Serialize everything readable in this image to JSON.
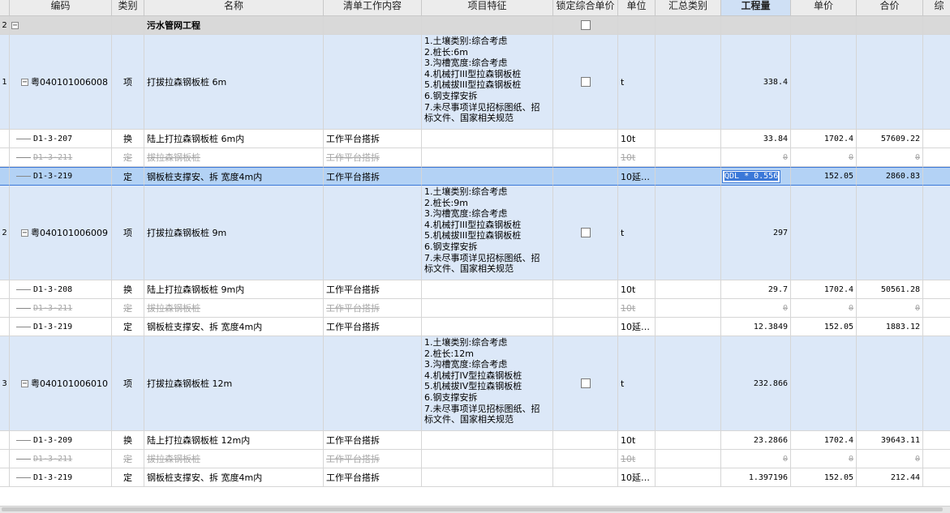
{
  "columns": [
    "编码",
    "类别",
    "名称",
    "清单工作内容",
    "项目特征",
    "锁定综合单价",
    "单位",
    "汇总类别",
    "工程量",
    "单价",
    "合价",
    "综"
  ],
  "rows": [
    {
      "type": "group",
      "idx": "2",
      "code": "",
      "cat": "",
      "name": "污水管网工程",
      "work": "",
      "unit": "",
      "qty": "",
      "price": "",
      "total": ""
    },
    {
      "type": "item",
      "idx": "1",
      "code": "粤040101006008",
      "cat": "项",
      "name": "打拔拉森钢板桩 6m",
      "work": "",
      "unit": "t",
      "qty": "338.4",
      "price": "",
      "total": "",
      "features": [
        "1.土壤类别:综合考虑",
        "2.桩长:6m",
        "3.沟槽宽度:综合考虑",
        "4.机械打III型拉森钢板桩",
        "5.机械拔III型拉森钢板桩",
        "6.钢支撑安拆",
        "7.未尽事项详见招标图纸、招",
        "标文件、国家相关规范"
      ]
    },
    {
      "type": "sub",
      "code": "D1-3-207",
      "cat": "换",
      "name": "陆上打拉森钢板桩 6m内",
      "work": "工作平台搭拆",
      "unit": "10t",
      "qty": "33.84",
      "price": "1702.4",
      "total": "57609.22"
    },
    {
      "type": "struck",
      "code": "D1-3-211",
      "cat": "定",
      "name": "拔拉森钢板桩",
      "work": "工作平台搭拆",
      "unit": "10t",
      "qty": "0",
      "price": "0",
      "total": "0"
    },
    {
      "type": "sel",
      "code": "D1-3-219",
      "cat": "定",
      "name": "钢板桩支撑安、拆 宽度4m内",
      "work": "工作平台搭拆",
      "unit": "10延…",
      "qty": "QDL * 0.556",
      "price": "152.05",
      "total": "2860.83"
    },
    {
      "type": "item",
      "idx": "2",
      "code": "粤040101006009",
      "cat": "项",
      "name": "打拔拉森钢板桩 9m",
      "work": "",
      "unit": "t",
      "qty": "297",
      "price": "",
      "total": "",
      "features": [
        "1.土壤类别:综合考虑",
        "2.桩长:9m",
        "3.沟槽宽度:综合考虑",
        "4.机械打III型拉森钢板桩",
        "5.机械拔III型拉森钢板桩",
        "6.钢支撑安拆",
        "7.未尽事项详见招标图纸、招",
        "标文件、国家相关规范"
      ]
    },
    {
      "type": "sub",
      "code": "D1-3-208",
      "cat": "换",
      "name": "陆上打拉森钢板桩 9m内",
      "work": "工作平台搭拆",
      "unit": "10t",
      "qty": "29.7",
      "price": "1702.4",
      "total": "50561.28"
    },
    {
      "type": "struck",
      "code": "D1-3-211",
      "cat": "定",
      "name": "拔拉森钢板桩",
      "work": "工作平台搭拆",
      "unit": "10t",
      "qty": "0",
      "price": "0",
      "total": "0"
    },
    {
      "type": "sub",
      "code": "D1-3-219",
      "cat": "定",
      "name": "钢板桩支撑安、拆 宽度4m内",
      "work": "工作平台搭拆",
      "unit": "10延…",
      "qty": "12.3849",
      "price": "152.05",
      "total": "1883.12"
    },
    {
      "type": "item",
      "idx": "3",
      "code": "粤040101006010",
      "cat": "项",
      "name": "打拔拉森钢板桩 12m",
      "work": "",
      "unit": "t",
      "qty": "232.866",
      "price": "",
      "total": "",
      "features": [
        "1.土壤类别:综合考虑",
        "2.桩长:12m",
        "3.沟槽宽度:综合考虑",
        "4.机械打IV型拉森钢板桩",
        "5.机械拔IV型拉森钢板桩",
        "6.钢支撑安拆",
        "7.未尽事项详见招标图纸、招",
        "标文件、国家相关规范"
      ]
    },
    {
      "type": "sub",
      "code": "D1-3-209",
      "cat": "换",
      "name": "陆上打拉森钢板桩 12m内",
      "work": "工作平台搭拆",
      "unit": "10t",
      "qty": "23.2866",
      "price": "1702.4",
      "total": "39643.11"
    },
    {
      "type": "struck",
      "code": "D1-3-211",
      "cat": "定",
      "name": "拔拉森钢板桩",
      "work": "工作平台搭拆",
      "unit": "10t",
      "qty": "0",
      "price": "0",
      "total": "0"
    },
    {
      "type": "sub",
      "code": "D1-3-219",
      "cat": "定",
      "name": "钢板桩支撑安、拆 宽度4m内",
      "work": "工作平台搭拆",
      "unit": "10延…",
      "qty": "1.397196",
      "price": "152.05",
      "total": "212.44"
    }
  ]
}
